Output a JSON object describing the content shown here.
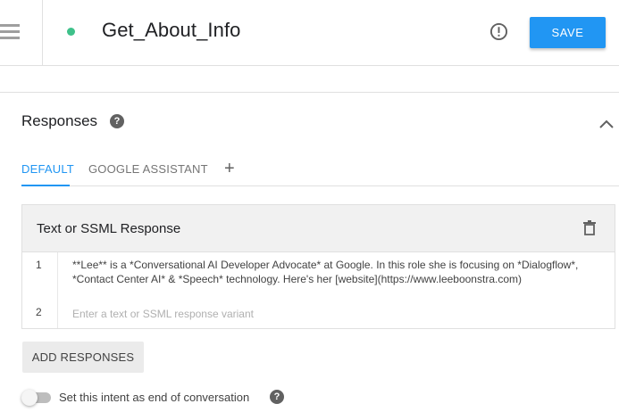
{
  "header": {
    "intent_name": "Get_About_Info",
    "status_dot_color": "#3ec18a",
    "save_label": "SAVE",
    "info_icon": "exclamation-circle-icon",
    "menu_icon": "hamburger-menu-icon"
  },
  "responses": {
    "title": "Responses",
    "help_icon": "question-circle-icon",
    "collapse_icon": "chevron-up-icon",
    "tabs": [
      {
        "label": "DEFAULT",
        "active": true
      },
      {
        "label": "GOOGLE ASSISTANT",
        "active": false
      }
    ],
    "add_tab_label": "+",
    "card": {
      "title": "Text or SSML Response",
      "delete_icon": "trash-icon",
      "lines": [
        {
          "number": "1",
          "text": "**Lee**  is a *Conversational AI Developer Advocate* at Google. In this role she is focusing on *Dialogflow*, *Contact Center AI* & *Speech* technology. Here's her  [website](https://www.leeboonstra.com)"
        },
        {
          "number": "2",
          "placeholder": "Enter a text or SSML response variant"
        }
      ]
    },
    "add_responses_label": "ADD RESPONSES",
    "end_conversation": {
      "label": "Set this intent as end of conversation",
      "enabled": false
    }
  },
  "colors": {
    "accent": "#2196f3",
    "status": "#3ec18a"
  }
}
